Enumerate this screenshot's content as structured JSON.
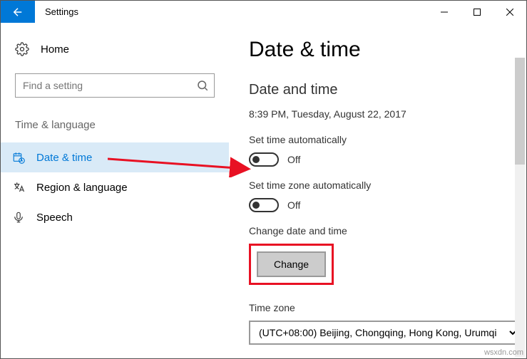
{
  "window": {
    "title": "Settings"
  },
  "sidebar": {
    "home_label": "Home",
    "search_placeholder": "Find a setting",
    "category": "Time & language",
    "items": [
      {
        "label": "Date & time"
      },
      {
        "label": "Region & language"
      },
      {
        "label": "Speech"
      }
    ]
  },
  "content": {
    "heading": "Date & time",
    "subheading": "Date and time",
    "current_time": "8:39 PM, Tuesday, August 22, 2017",
    "set_time_auto_label": "Set time automatically",
    "set_time_auto_state": "Off",
    "set_tz_auto_label": "Set time zone automatically",
    "set_tz_auto_state": "Off",
    "change_label": "Change date and time",
    "change_button": "Change",
    "timezone_label": "Time zone",
    "timezone_value": "(UTC+08:00) Beijing, Chongqing, Hong Kong, Urumqi"
  },
  "watermark": "wsxdn.com"
}
